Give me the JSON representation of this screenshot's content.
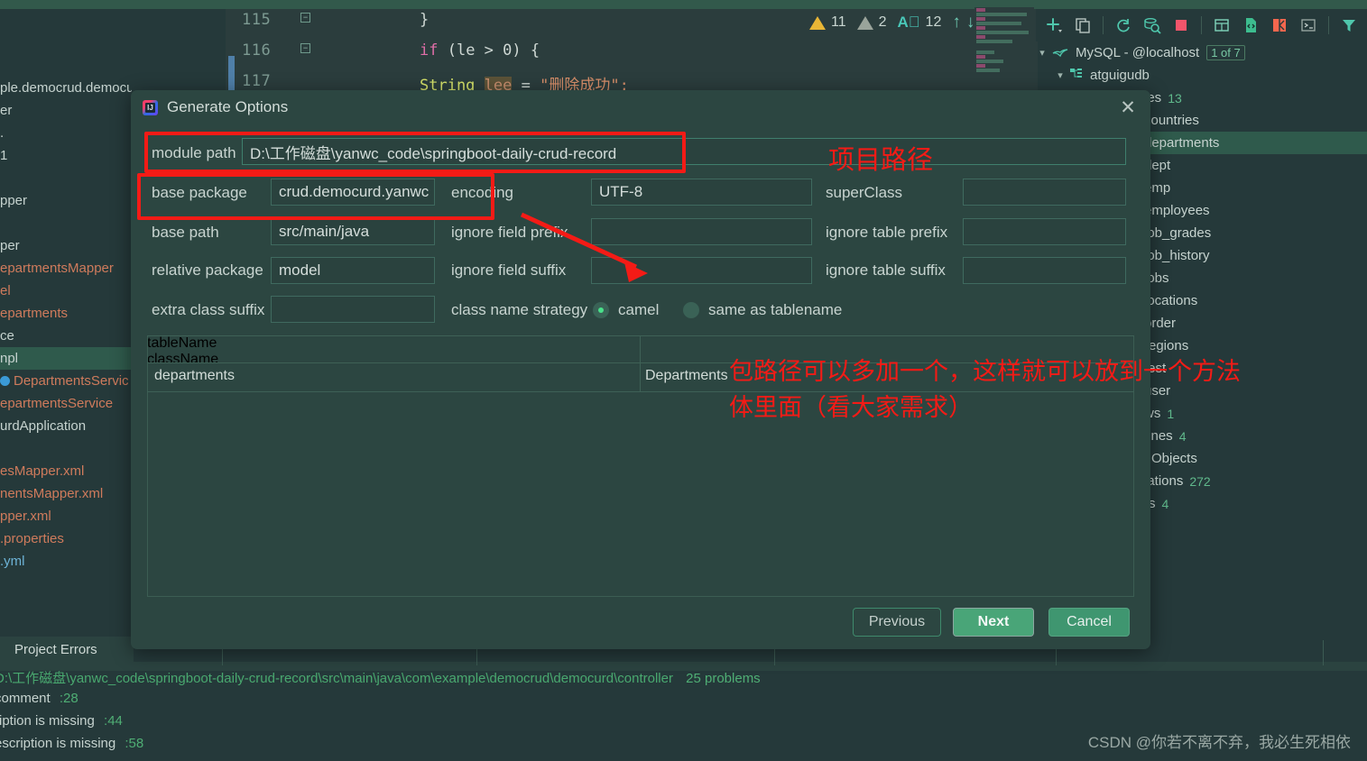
{
  "editor": {
    "lines": [
      {
        "no": "115",
        "tokens": [
          {
            "t": "}",
            "c": "pl"
          }
        ]
      },
      {
        "no": "116",
        "tokens": [
          {
            "t": "if ",
            "c": "kw"
          },
          {
            "t": "(le > ",
            "c": "pl"
          },
          {
            "t": "0",
            "c": "num"
          },
          {
            "t": ") {",
            "c": "pl"
          }
        ]
      },
      {
        "no": "117",
        "tokens": [
          {
            "t": "    String ",
            "c": "ty"
          },
          {
            "t": "lee",
            "c": "var"
          },
          {
            "t": " = ",
            "c": "pl"
          },
          {
            "t": "\"删除成功\";",
            "c": "str"
          }
        ]
      }
    ],
    "line_numbers": [
      "115",
      "116",
      "117"
    ],
    "code_115": "}",
    "code_116_kw": "if",
    "code_116_rest": " (le > 0) {",
    "code_117_type": "String",
    "code_117_var": "lee",
    "code_117_eq": " = ",
    "code_117_str": "\"删除成功\";",
    "inspection": {
      "warning_count": "11",
      "weak_warning_count": "2",
      "typo_count": "12",
      "prev_arrow": "↑",
      "next_arrow": "↓"
    }
  },
  "db_toolbar": {
    "icons": [
      {
        "name": "add-icon",
        "glyph": "+"
      },
      {
        "name": "duplicate-icon",
        "glyph": "❐"
      },
      {
        "name": "refresh-icon",
        "glyph": "⟳"
      },
      {
        "name": "search-db-icon",
        "glyph": "🔍"
      },
      {
        "name": "stop-icon",
        "glyph": "■"
      },
      {
        "name": "table-icon",
        "glyph": "▦"
      },
      {
        "name": "query-file-icon",
        "glyph": "🗎"
      },
      {
        "name": "diagram-icon",
        "glyph": "◩"
      },
      {
        "name": "console-icon",
        "glyph": ">_"
      },
      {
        "name": "filter-icon",
        "glyph": "▼"
      }
    ]
  },
  "db_tree": {
    "root": {
      "label": "MySQL - @localhost",
      "badge": "1 of 7"
    },
    "schema": {
      "label": "atguigudb"
    },
    "nodes": [
      {
        "label": "les",
        "count": "13",
        "indent": 0,
        "selected": false
      },
      {
        "label": "countries",
        "count": "",
        "indent": 0,
        "selected": false
      },
      {
        "label": "departments",
        "count": "",
        "indent": 0,
        "selected": true
      },
      {
        "label": "dept",
        "count": "",
        "indent": 0,
        "selected": false
      },
      {
        "label": "emp",
        "count": "",
        "indent": 0,
        "selected": false
      },
      {
        "label": "employees",
        "count": "",
        "indent": 0,
        "selected": false
      },
      {
        "label": "job_grades",
        "count": "",
        "indent": 0,
        "selected": false
      },
      {
        "label": "job_history",
        "count": "",
        "indent": 0,
        "selected": false
      },
      {
        "label": "jobs",
        "count": "",
        "indent": 0,
        "selected": false
      },
      {
        "label": "locations",
        "count": "",
        "indent": 0,
        "selected": false
      },
      {
        "label": "order",
        "count": "",
        "indent": 0,
        "selected": false
      },
      {
        "label": "regions",
        "count": "",
        "indent": 0,
        "selected": false
      },
      {
        "label": "test",
        "count": "",
        "indent": 0,
        "selected": false
      },
      {
        "label": "user",
        "count": "",
        "indent": 0,
        "selected": false
      },
      {
        "label": "ws",
        "count": "1",
        "indent": 0,
        "selected": false
      },
      {
        "label": "tines",
        "count": "4",
        "indent": 0,
        "selected": false
      },
      {
        "label": "Objects",
        "count": "",
        "indent": 1,
        "selected": false
      },
      {
        "label": "lations",
        "count": "272",
        "indent": 0,
        "selected": false
      },
      {
        "label": "rs",
        "count": "4",
        "indent": 0,
        "selected": false
      }
    ]
  },
  "project_tree": {
    "items": [
      {
        "label": "ple.democrud.democurd",
        "color": "normal"
      },
      {
        "label": "er",
        "color": "normal"
      },
      {
        "label": ".",
        "color": "normal"
      },
      {
        "label": "1",
        "color": "normal"
      },
      {
        "label": "",
        "color": "normal"
      },
      {
        "label": "pper",
        "color": "normal"
      },
      {
        "label": "",
        "color": "normal"
      },
      {
        "label": "per",
        "color": "normal"
      },
      {
        "label": "epartmentsMapper",
        "color": "orange"
      },
      {
        "label": "el",
        "color": "orange"
      },
      {
        "label": "epartments",
        "color": "orange"
      },
      {
        "label": "ce",
        "color": "normal"
      },
      {
        "label": "npl",
        "color": "normal",
        "highlight": true
      },
      {
        "label": "DepartmentsServic",
        "color": "orange",
        "bean": true
      },
      {
        "label": "epartmentsService",
        "color": "orange"
      },
      {
        "label": "urdApplication",
        "color": "normal"
      },
      {
        "label": "",
        "color": "normal"
      },
      {
        "label": "esMapper.xml",
        "color": "orange"
      },
      {
        "label": "nentsMapper.xml",
        "color": "orange"
      },
      {
        "label": "pper.xml",
        "color": "orange"
      },
      {
        "label": ".properties",
        "color": "orange"
      },
      {
        "label": ".yml",
        "color": "blue"
      }
    ]
  },
  "dialog": {
    "title": "Generate Options",
    "close_glyph": "✕",
    "fields": {
      "module_path_label": "module path",
      "module_path_value": "D:\\工作磁盘\\yanwc_code\\springboot-daily-crud-record",
      "base_package_label": "base package",
      "base_package_value": "crud.democurd.yanwc",
      "encoding_label": "encoding",
      "encoding_value": "UTF-8",
      "super_class_label": "superClass",
      "super_class_value": "",
      "base_path_label": "base path",
      "base_path_value": "src/main/java",
      "ignore_field_prefix_label": "ignore field prefix",
      "ignore_field_prefix_value": "",
      "ignore_table_prefix_label": "ignore table prefix",
      "ignore_table_prefix_value": "",
      "relative_package_label": "relative package",
      "relative_package_value": "model",
      "ignore_field_suffix_label": "ignore field suffix",
      "ignore_field_suffix_value": "",
      "ignore_table_suffix_label": "ignore table suffix",
      "ignore_table_suffix_value": "",
      "extra_class_suffix_label": "extra class suffix",
      "extra_class_suffix_value": "",
      "class_name_strategy_label": "class name strategy",
      "radio_camel_label": "camel",
      "radio_same_label": "same as tablename",
      "radio_selected": "camel"
    },
    "table": {
      "columns": [
        "tableName",
        "className"
      ],
      "rows": [
        [
          "departments",
          "Departments"
        ]
      ]
    },
    "buttons": {
      "previous": "Previous",
      "next": "Next",
      "cancel": "Cancel"
    }
  },
  "annotations": {
    "project_path_note": "项目路径",
    "package_note_line1": "包路径可以多加一个，这样就可以放到一个方法",
    "package_note_line2": "体里面（看大家需求）"
  },
  "bottom": {
    "tab_label": "Project Errors",
    "path_line": "D:\\工作磁盘\\yanwc_code\\springboot-daily-crud-record\\src\\main\\java\\com\\example\\democrud\\democurd\\controller",
    "path_line_count": "25 problems",
    "errors": [
      {
        "text": "comment",
        "line": ":28"
      },
      {
        "text": "ription is missing",
        "line": ":44"
      },
      {
        "text": "escription is missing",
        "line": ":58"
      }
    ]
  },
  "watermark": {
    "text": "CSDN @你若不离不弃，我必生死相依"
  },
  "colors": {
    "accent_green": "#49a578",
    "annotation_red": "#f41b16",
    "dialog_bg": "#2c4641",
    "ide_bg": "#25393a"
  }
}
